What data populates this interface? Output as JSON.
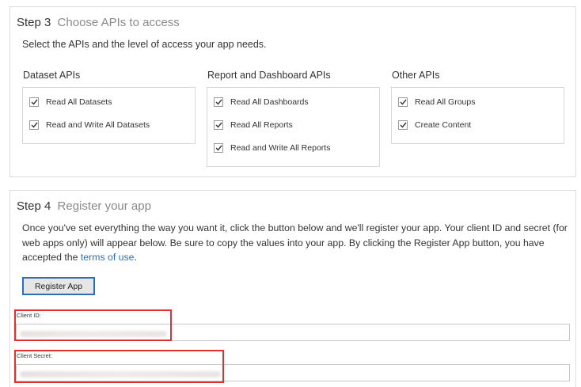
{
  "step3": {
    "number": "Step 3",
    "title": "Choose APIs to access",
    "intro": "Select the APIs and the level of access your app needs.",
    "groups": [
      {
        "title": "Dataset APIs",
        "items": [
          {
            "label": "Read All Datasets",
            "checked": true
          },
          {
            "label": "Read and Write All Datasets",
            "checked": true
          }
        ]
      },
      {
        "title": "Report and Dashboard APIs",
        "items": [
          {
            "label": "Read All Dashboards",
            "checked": true
          },
          {
            "label": "Read All Reports",
            "checked": true
          },
          {
            "label": "Read and Write All Reports",
            "checked": true
          }
        ]
      },
      {
        "title": "Other APIs",
        "items": [
          {
            "label": "Read All Groups",
            "checked": true
          },
          {
            "label": "Create Content",
            "checked": true
          }
        ]
      }
    ]
  },
  "step4": {
    "number": "Step 4",
    "title": "Register your app",
    "body_line1": "Once you've set everything the way you want it, click the button below and we'll register your app. Your client ID and secret (for",
    "body_line2": "web apps only) will appear below. Be sure to copy the values into your app. By clicking the Register App button, you have",
    "body_line3_prefix": "accepted the ",
    "terms_link": "terms of use",
    "body_line3_suffix": ".",
    "register_button": "Register App",
    "client_id_label": "Client ID:",
    "client_secret_label": "Client Secret:"
  },
  "colors": {
    "link": "#2a6ebb",
    "button_border": "#2c6fb6",
    "highlight": "#e03030"
  }
}
